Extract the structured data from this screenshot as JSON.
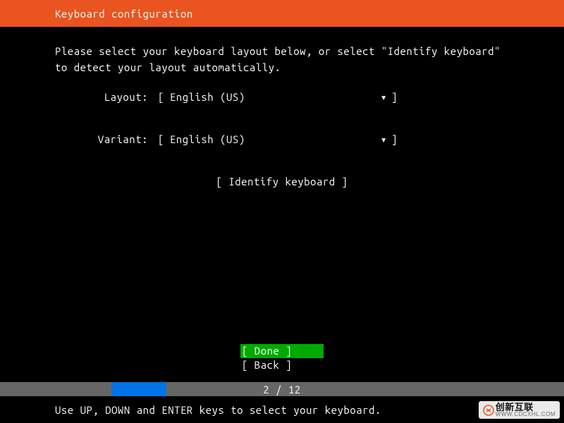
{
  "header": {
    "title": "Keyboard configuration"
  },
  "instruction": "Please select your keyboard layout below, or select \"Identify keyboard\" to detect your layout automatically.",
  "form": {
    "layout_label": "Layout:",
    "layout_value": "English (US)",
    "variant_label": "Variant:",
    "variant_value": "English (US)",
    "identify_label": "[ Identify keyboard ]"
  },
  "buttons": {
    "done": "[ Done       ]",
    "back": "[ Back       ]"
  },
  "progress": {
    "current": 2,
    "total": 12,
    "text": "2 / 12"
  },
  "help": "Use UP, DOWN and ENTER keys to select your keyboard.",
  "watermark": {
    "brand": "创新互联",
    "url": "WWW.CDCXHL.COM"
  },
  "glyphs": {
    "left_bracket": "[",
    "right_bracket": "]",
    "down_arrow": "▾"
  }
}
